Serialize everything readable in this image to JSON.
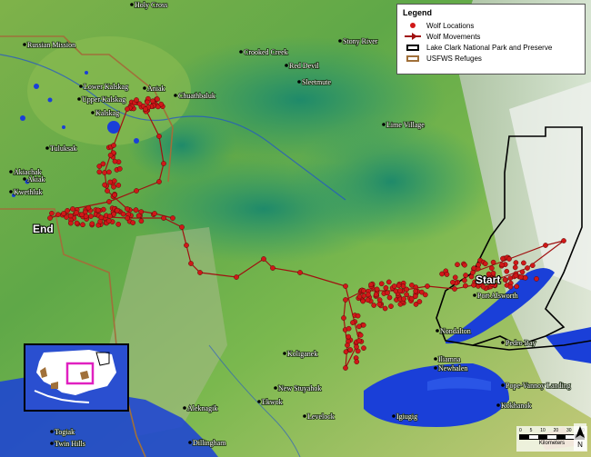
{
  "legend": {
    "title": "Legend",
    "items": [
      {
        "label": "Wolf Locations",
        "symbol": "red-dot"
      },
      {
        "label": "Wolf Movements",
        "symbol": "red-arrow"
      },
      {
        "label": "Lake Clark National Park and Preserve",
        "symbol": "black-outline"
      },
      {
        "label": "USFWS Refuges",
        "symbol": "brown-outline"
      }
    ]
  },
  "labels": {
    "start": "Start",
    "end": "End"
  },
  "towns": [
    "Holy Cross",
    "Russian Mission",
    "Lower Kalskag",
    "Upper Kalskag",
    "Kalskag",
    "Aniak",
    "Chuathbaluk",
    "Crooked Creek",
    "Red Devil",
    "Sleetmute",
    "Stony River",
    "Lime Village",
    "Tuluksak",
    "Akiachak",
    "Akiak",
    "Kwethluk",
    "Port Alsworth",
    "Nondalton",
    "Pedro Bay",
    "Iliamna",
    "Newhalen",
    "Pope-Vannoy Landing",
    "Kokhanok",
    "Igiugig",
    "Koliganek",
    "New Stuyahok",
    "Ekwok",
    "Aleknagik",
    "Levelock",
    "Dillingham",
    "Togiak",
    "Twin Hills"
  ],
  "scale": {
    "ticks": [
      "0",
      "5",
      "10",
      "20",
      "30",
      "40"
    ],
    "unit": "Kilometers"
  },
  "colors": {
    "wolf_points": "#d01818",
    "wolf_lines": "#a01010",
    "park_boundary": "#000000",
    "refuge_boundary": "#a0703a",
    "water": "#1a3fd8"
  },
  "icons": {
    "north": "north-arrow-icon"
  }
}
